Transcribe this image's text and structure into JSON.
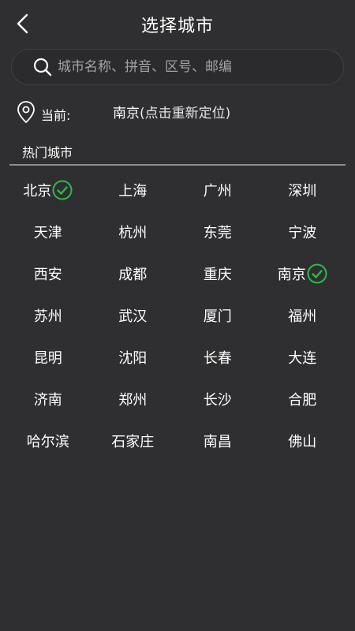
{
  "header": {
    "title": "选择城市",
    "back_icon": "chevron-left-icon"
  },
  "search": {
    "placeholder": "城市名称、拼音、区号、邮编",
    "value": "",
    "icon": "search-icon"
  },
  "current_location": {
    "icon": "location-pin-icon",
    "label": "当前:",
    "city": "南京",
    "hint": "(点击重新定位)"
  },
  "hot_cities": {
    "title": "热门城市",
    "selected_icon": "check-circle-icon",
    "accent_color": "#2eb84a",
    "rows": [
      [
        {
          "name": "北京",
          "selected": true
        },
        {
          "name": "上海",
          "selected": false
        },
        {
          "name": "广州",
          "selected": false
        },
        {
          "name": "深圳",
          "selected": false
        }
      ],
      [
        {
          "name": "天津",
          "selected": false
        },
        {
          "name": "杭州",
          "selected": false
        },
        {
          "name": "东莞",
          "selected": false
        },
        {
          "name": "宁波",
          "selected": false
        }
      ],
      [
        {
          "name": "西安",
          "selected": false
        },
        {
          "name": "成都",
          "selected": false
        },
        {
          "name": "重庆",
          "selected": false
        },
        {
          "name": "南京",
          "selected": true
        }
      ],
      [
        {
          "name": "苏州",
          "selected": false
        },
        {
          "name": "武汉",
          "selected": false
        },
        {
          "name": "厦门",
          "selected": false
        },
        {
          "name": "福州",
          "selected": false
        }
      ],
      [
        {
          "name": "昆明",
          "selected": false
        },
        {
          "name": "沈阳",
          "selected": false
        },
        {
          "name": "长春",
          "selected": false
        },
        {
          "name": "大连",
          "selected": false
        }
      ],
      [
        {
          "name": "济南",
          "selected": false
        },
        {
          "name": "郑州",
          "selected": false
        },
        {
          "name": "长沙",
          "selected": false
        },
        {
          "name": "合肥",
          "selected": false
        }
      ],
      [
        {
          "name": "哈尔滨",
          "selected": false
        },
        {
          "name": "石家庄",
          "selected": false
        },
        {
          "name": "南昌",
          "selected": false
        },
        {
          "name": "佛山",
          "selected": false
        }
      ]
    ]
  }
}
